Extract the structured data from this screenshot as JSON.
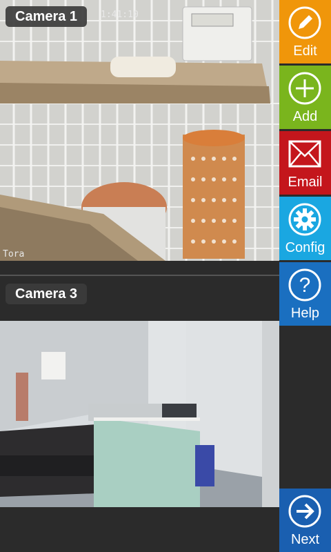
{
  "cameras": [
    {
      "label": "Camera 1",
      "timestamp": "1:41:10",
      "overlay": "Tora"
    },
    {
      "label": "Camera 3"
    }
  ],
  "sidebar": {
    "items": [
      {
        "label": "Edit",
        "icon": "pencil-icon",
        "color": "#f0960a"
      },
      {
        "label": "Add",
        "icon": "plus-icon",
        "color": "#7ab51d"
      },
      {
        "label": "Email",
        "icon": "envelope-icon",
        "color": "#c4161c"
      },
      {
        "label": "Config",
        "icon": "gear-icon",
        "color": "#1aa7e1"
      },
      {
        "label": "Help",
        "icon": "question-icon",
        "color": "#1a6fc0"
      },
      {
        "label": "Next",
        "icon": "arrow-right-icon",
        "color": "#1a5fb0"
      }
    ]
  }
}
